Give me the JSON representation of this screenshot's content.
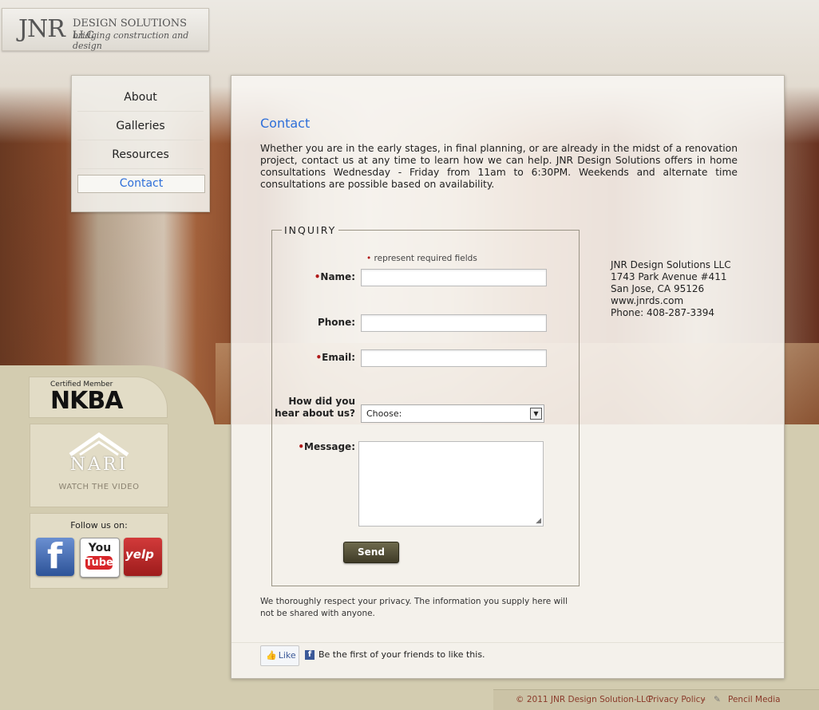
{
  "logo": {
    "mark": "JNR",
    "name": "DESIGN SOLUTIONS LLC",
    "tagline": "bridging construction and design"
  },
  "nav": {
    "items": [
      {
        "label": "About"
      },
      {
        "label": "Galleries"
      },
      {
        "label": "Resources"
      },
      {
        "label": "Contact"
      }
    ],
    "active": "Contact"
  },
  "sidebar": {
    "nkba_certified": "Certified Member",
    "nkba_word": "NKBA",
    "nari_word": "NARI",
    "nari_video": "WATCH THE VIDEO",
    "follow_label": "Follow us on:",
    "social": [
      {
        "name": "facebook",
        "glyph": "f"
      },
      {
        "name": "youtube",
        "you": "You",
        "tube": "Tube"
      },
      {
        "name": "yelp",
        "glyph": "yelp"
      }
    ]
  },
  "main": {
    "title": "Contact",
    "intro": "Whether you are in the early stages, in final planning, or are already in the midst of a renovation project, contact us at any time to learn how we can help. JNR Design Solutions offers in home consultations Wednesday - Friday from 11am to 6:30PM. Weekends and alternate time consultations are possible based on availability."
  },
  "form": {
    "legend": "INQUIRY",
    "required_note": "represent required fields",
    "labels": {
      "name": "Name:",
      "phone": "Phone:",
      "email": "Email:",
      "hear_1": "How did you",
      "hear_2": "hear about us?",
      "message": "Message:"
    },
    "values": {
      "name": "",
      "phone": "",
      "email": "",
      "message": ""
    },
    "hear_selected": "Choose:",
    "send_label": "Send"
  },
  "address": {
    "company": "JNR Design Solutions LLC",
    "street": "1743 Park Avenue #411",
    "city": "San Jose, CA 95126",
    "web": "www.jnrds.com",
    "phone": "Phone: 408-287-3394"
  },
  "privacy": "We thoroughly respect your privacy. The information you supply here will not be shared with anyone.",
  "facebook_like": {
    "button": "Like",
    "text": "Be the first of your friends to like this."
  },
  "footer": {
    "copyright": "© 2011 JNR Design Solution LLC",
    "privacy_link": "Privacy Policy",
    "credit": "Pencil Media"
  },
  "colors": {
    "accent": "#2e6fd9",
    "send_button": "#4a4630",
    "required_star": "#b01818"
  }
}
